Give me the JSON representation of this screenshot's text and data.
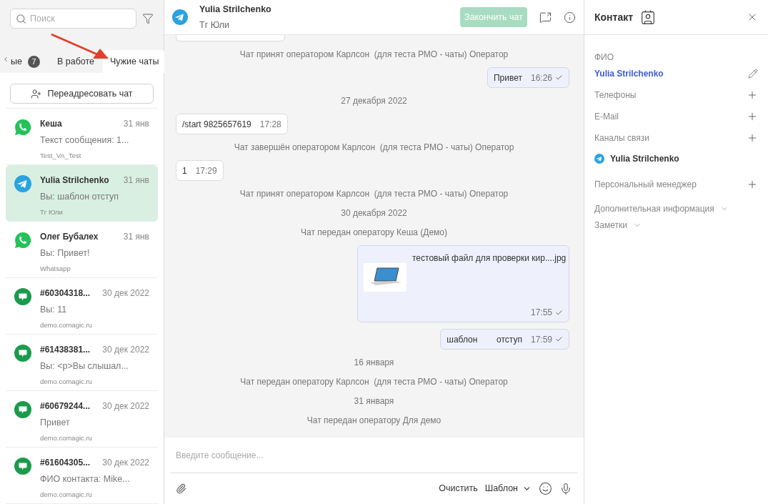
{
  "search": {
    "placeholder": "Поиск"
  },
  "tabs": [
    {
      "label": "ые",
      "badge": "7",
      "selected": false
    },
    {
      "label": "В работе",
      "selected": false
    },
    {
      "label": "Чужие чаты",
      "selected": true
    }
  ],
  "forward_button": "Переадресовать чат",
  "chats": [
    {
      "kind": "whatsapp",
      "name": "Кеша",
      "date": "31 янв",
      "preview": "Текст сообщения: 1...",
      "source": "Test_VA_Test",
      "selected": false
    },
    {
      "kind": "telegram",
      "name": "Yulia Strilchenko",
      "date": "31 янв",
      "preview": "Вы: шаблон отступ",
      "source": "Тг Юли",
      "selected": true
    },
    {
      "kind": "whatsapp",
      "name": "Олег Бубалех",
      "date": "31 янв",
      "preview": "Вы: Привет!",
      "source": "Whatsapp",
      "selected": false
    },
    {
      "kind": "site",
      "name": "#60304318...",
      "date": "30 дек 2022",
      "preview": "Вы: 11",
      "source": "demo.comagic.ru",
      "selected": false
    },
    {
      "kind": "site",
      "name": "#61438381...",
      "date": "30 дек 2022",
      "preview": "Вы: <p>Вы слышал...",
      "source": "demo.comagic.ru",
      "selected": false
    },
    {
      "kind": "site",
      "name": "#60679244...",
      "date": "30 дек 2022",
      "preview": "Привет",
      "source": "demo.comagic.ru",
      "selected": false
    },
    {
      "kind": "site",
      "name": "#61604305...",
      "date": "30 дек 2022",
      "preview": "ФИО контакта: Mike...",
      "source": "demo.comagic.ru",
      "selected": false
    }
  ],
  "chat_header": {
    "name": "Yulia Strilchenko",
    "channel": "Тг Юли",
    "end_button": "Закончить чат"
  },
  "messages": [
    {
      "kind": "system",
      "text": "Чат принят оператором Карлсон  (для теста РМО - чаты) Оператор"
    },
    {
      "kind": "out",
      "text": "Привет",
      "time": "16:26"
    },
    {
      "kind": "date",
      "text": "27 декабря 2022"
    },
    {
      "kind": "in",
      "text": "/start 9825657619",
      "time": "17:28"
    },
    {
      "kind": "system",
      "text": "Чат завершён оператором Карлсон  (для теста РМО - чаты) Оператор"
    },
    {
      "kind": "in",
      "text": "1",
      "time": "17:29"
    },
    {
      "kind": "system",
      "text": "Чат принят оператором Карлсон  (для теста РМО - чаты) Оператор"
    },
    {
      "kind": "date",
      "text": "30 декабря 2022"
    },
    {
      "kind": "system",
      "text": "Чат передан оператору Кеша (Демо)"
    },
    {
      "kind": "file",
      "text": "тестовый файл для проверки кир....jpg",
      "time": "17:55"
    },
    {
      "kind": "out",
      "text": "шаблон        отступ",
      "time": "17:59"
    },
    {
      "kind": "date",
      "text": "16 января"
    },
    {
      "kind": "system",
      "text": "Чат передан оператору Карлсон  (для теста РМО - чаты) Оператор"
    },
    {
      "kind": "date",
      "text": "31 января"
    },
    {
      "kind": "system",
      "text": "Чат передан оператору Для демо"
    }
  ],
  "composer": {
    "placeholder": "Введите сообщение...",
    "clear": "Очистить",
    "template": "Шаблон"
  },
  "contact": {
    "title": "Контакт",
    "fio_label": "ФИО",
    "fio_value": "Yulia Strilchenko",
    "fields": [
      {
        "label": "Телефоны"
      },
      {
        "label": "E-Mail"
      },
      {
        "label": "Каналы связи"
      }
    ],
    "channel": "Yulia Strilchenko",
    "manager": "Персональный менеджер",
    "sections": [
      "Дополнительная информация",
      "Заметки"
    ]
  }
}
